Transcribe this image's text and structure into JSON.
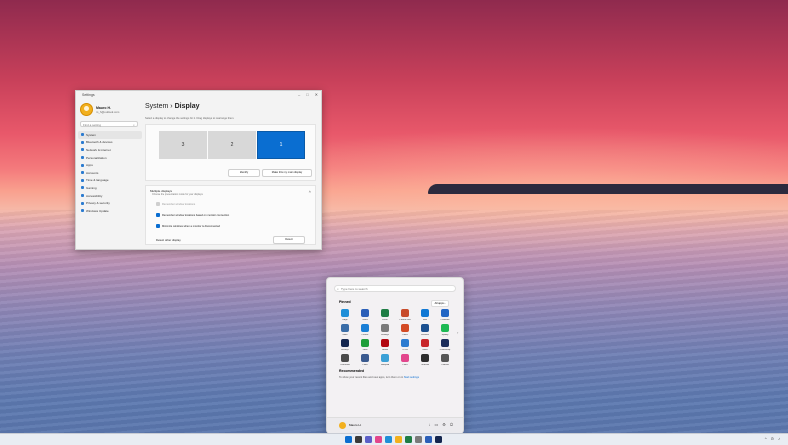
{
  "settings": {
    "window_title": "Settings",
    "window_controls": [
      "–",
      "□",
      "✕"
    ],
    "user": {
      "name": "Mauro H.",
      "email": "m_h@outlook.com"
    },
    "search_placeholder": "Find a setting",
    "nav": [
      "System",
      "Bluetooth & devices",
      "Network & internet",
      "Personalization",
      "Apps",
      "Accounts",
      "Time & language",
      "Gaming",
      "Accessibility",
      "Privacy & security",
      "Windows Update"
    ],
    "breadcrumb_parent": "System",
    "breadcrumb_sep": "›",
    "breadcrumb_current": "Display",
    "description": "Select a display to change the settings for it. Drag displays to rearrange them.",
    "monitors": [
      "3",
      "2",
      "1"
    ],
    "identify_label": "Identify",
    "make_main_label": "Make this my main display",
    "multiple_displays": {
      "title": "Multiple displays",
      "subtitle": "Choose the presentation mode for your displays",
      "options": [
        "Remember window locations",
        "Remember window locations based on monitor connection",
        "Minimize windows when a monitor is disconnected"
      ],
      "detect_label": "Detect other display",
      "detect_button": "Detect"
    }
  },
  "start_menu": {
    "search_placeholder": "Type here to search",
    "pinned_label": "Pinned",
    "all_apps_label": "All apps  ›",
    "apps": [
      {
        "label": "Edge",
        "color": "#1f8fd8"
      },
      {
        "label": "Word",
        "color": "#2b5fb8"
      },
      {
        "label": "Excel",
        "color": "#1e7d45"
      },
      {
        "label": "PowerPoint",
        "color": "#c84b2a"
      },
      {
        "label": "Mail",
        "color": "#0f78d4"
      },
      {
        "label": "Calendar",
        "color": "#2165c4"
      },
      {
        "label": "Store",
        "color": "#3b6ea8"
      },
      {
        "label": "Photos",
        "color": "#1a7fd6"
      },
      {
        "label": "Settings",
        "color": "#7a7a7a"
      },
      {
        "label": "Office",
        "color": "#d34a24"
      },
      {
        "label": "Solitaire",
        "color": "#1a4f8f"
      },
      {
        "label": "Spotify",
        "color": "#1db954"
      },
      {
        "label": "Disney+",
        "color": "#14264f"
      },
      {
        "label": "Xbox",
        "color": "#1f9e3a"
      },
      {
        "label": "Netflix",
        "color": "#b20710"
      },
      {
        "label": "To Do",
        "color": "#2b7bd0"
      },
      {
        "label": "News",
        "color": "#c8262a"
      },
      {
        "label": "Photoshop",
        "color": "#1b2c5a"
      },
      {
        "label": "Calculator",
        "color": "#4a4a4a"
      },
      {
        "label": "Clock",
        "color": "#3a5a8f"
      },
      {
        "label": "Notepad",
        "color": "#3aa0d6"
      },
      {
        "label": "Paint",
        "color": "#e2468c"
      },
      {
        "label": "Terminal",
        "color": "#2d2d2d"
      },
      {
        "label": "Camera",
        "color": "#555555"
      }
    ],
    "recommended_label": "Recommended",
    "recommended_text": "To show your recent files and new apps, turn them on in ",
    "recommended_link": "Start settings",
    "footer_user": "Mauro H."
  },
  "taskbar": {
    "icon_colors": [
      "#0a6ed1",
      "#3a3a3a",
      "#5b5fc7",
      "#e2468c",
      "#1f8fd8",
      "#f2b01e",
      "#1e7d45",
      "#7a7a7a",
      "#2b5fb8",
      "#14264f"
    ],
    "tray_chevron": "^",
    "tray_symbols": [
      "⊙",
      "♪"
    ]
  }
}
